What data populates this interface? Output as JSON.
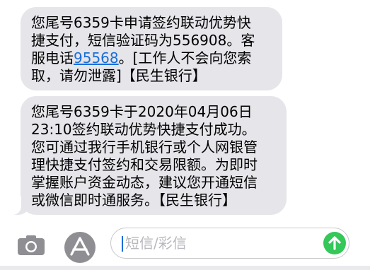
{
  "messages": [
    {
      "lines": [
        "您尾号6359卡申请签约联动优势快",
        "捷支付，短信验证码为556908。客",
        "服电话"
      ],
      "phone": "95568",
      "after_phone": "。[工作人不会向您索",
      "last_line": "取，请勿泄露]【民生银行】"
    },
    {
      "lines": [
        "您尾号6359卡于2020年04月06日",
        "23:10签约联动优势快捷支付成功。",
        "您可通过我行手机银行或个人网银管",
        "理快捷支付签约和交易限额。为即时",
        "掌握账户资金动态，建议您开通短信",
        "或微信即时通服务。【民生银行】"
      ]
    }
  ],
  "composer": {
    "placeholder": "短信/彩信",
    "camera_icon": "camera-icon",
    "apps_icon": "app-store-icon",
    "send_icon": "send-arrow-icon"
  },
  "colors": {
    "bubble": "#e5e5ea",
    "link": "#1a6ed8",
    "send": "#34c759",
    "icon_gray": "#8e8e93"
  }
}
